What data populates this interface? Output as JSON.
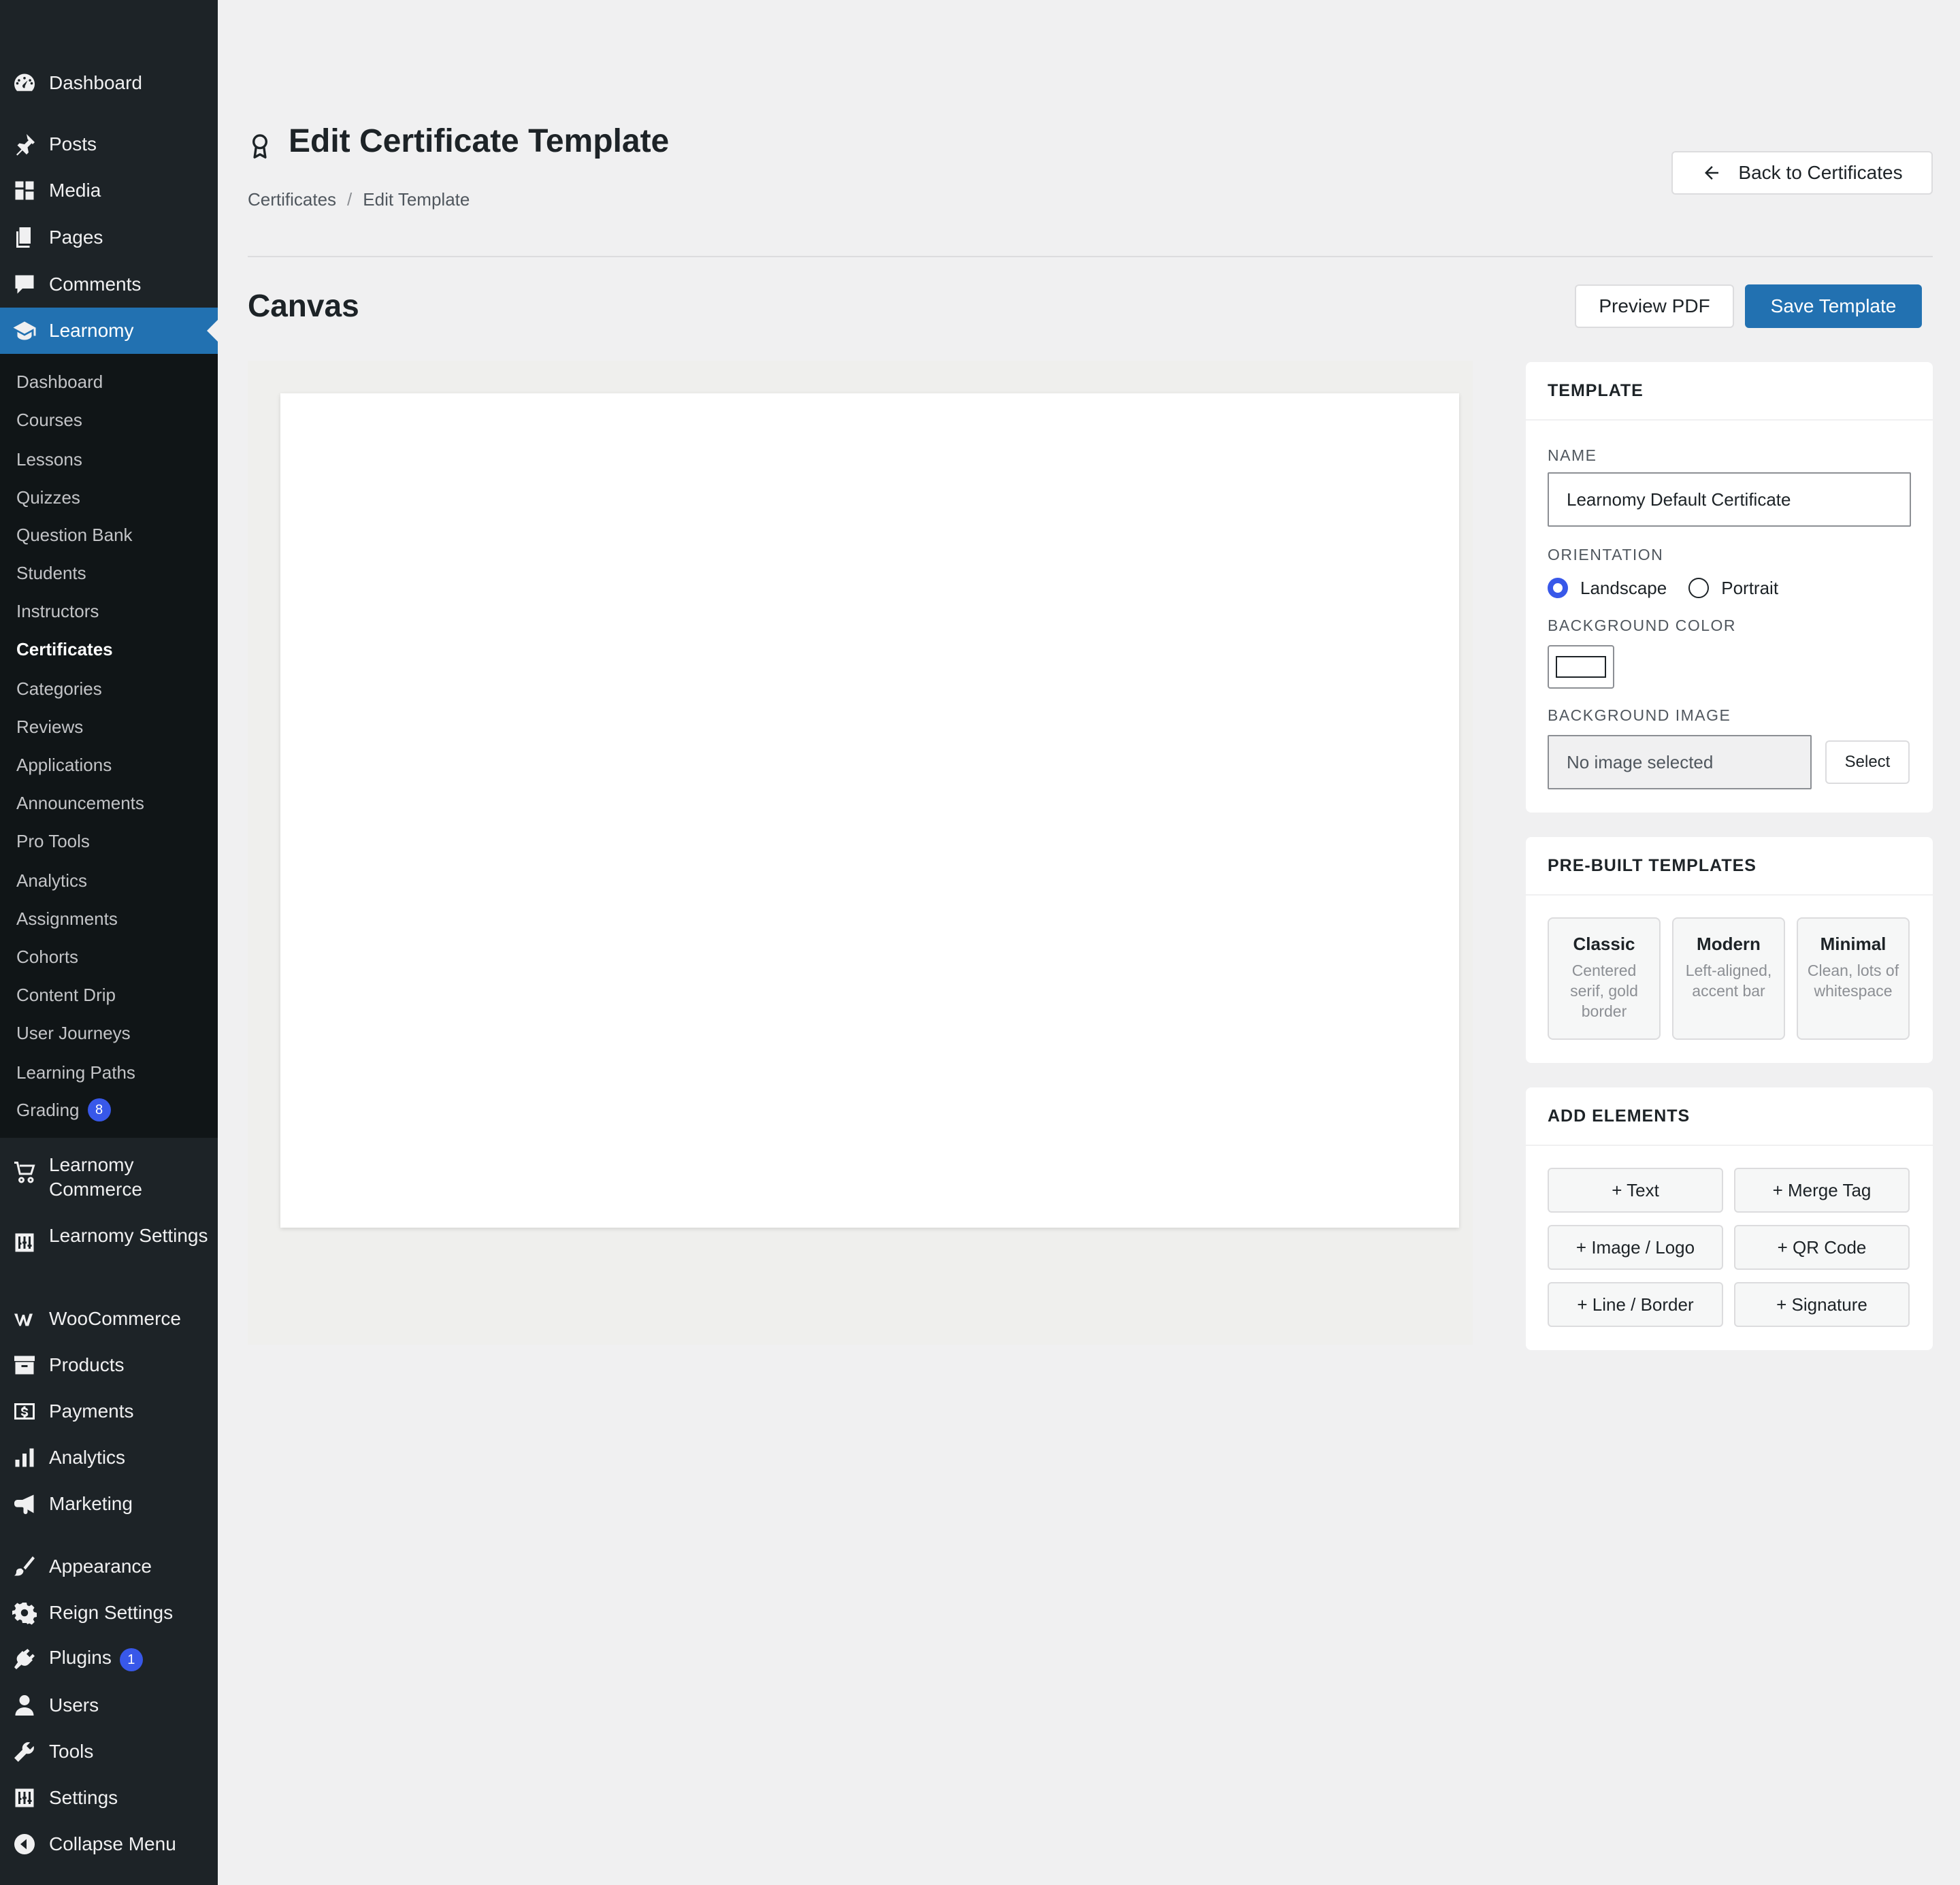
{
  "sidebar": {
    "top_items": [
      {
        "label": "Dashboard",
        "icon": "dashboard-icon"
      },
      {
        "label": "Posts",
        "icon": "pin-icon"
      },
      {
        "label": "Media",
        "icon": "media-icon"
      },
      {
        "label": "Pages",
        "icon": "pages-icon"
      },
      {
        "label": "Comments",
        "icon": "comment-icon"
      },
      {
        "label": "Learnomy",
        "icon": "graduation-cap-icon"
      }
    ],
    "submenu": [
      {
        "label": "Dashboard"
      },
      {
        "label": "Courses"
      },
      {
        "label": "Lessons"
      },
      {
        "label": "Quizzes"
      },
      {
        "label": "Question Bank"
      },
      {
        "label": "Students"
      },
      {
        "label": "Instructors"
      },
      {
        "label": "Certificates"
      },
      {
        "label": "Categories"
      },
      {
        "label": "Reviews"
      },
      {
        "label": "Applications"
      },
      {
        "label": "Announcements"
      },
      {
        "label": "Pro Tools"
      },
      {
        "label": "Analytics"
      },
      {
        "label": "Assignments"
      },
      {
        "label": "Cohorts"
      },
      {
        "label": "Content Drip"
      },
      {
        "label": "User Journeys"
      },
      {
        "label": "Learning Paths"
      },
      {
        "label": "Grading",
        "badge": "8"
      }
    ],
    "lower_items": [
      {
        "label": "Learnomy Commerce",
        "icon": "cart-icon"
      },
      {
        "label": "Learnomy Settings",
        "icon": "settings-sliders-icon"
      },
      {
        "label": "WooCommerce",
        "icon": "woocommerce-icon"
      },
      {
        "label": "Products",
        "icon": "archive-icon"
      },
      {
        "label": "Payments",
        "icon": "dollar-icon"
      },
      {
        "label": "Analytics",
        "icon": "bar-chart-icon"
      },
      {
        "label": "Marketing",
        "icon": "megaphone-icon"
      },
      {
        "label": "Appearance",
        "icon": "paintbrush-icon"
      },
      {
        "label": "Reign Settings",
        "icon": "gear-icon"
      },
      {
        "label": "Plugins",
        "icon": "plug-icon",
        "badge": "1"
      },
      {
        "label": "Users",
        "icon": "user-icon"
      },
      {
        "label": "Tools",
        "icon": "wrench-icon"
      },
      {
        "label": "Settings",
        "icon": "settings-sliders-icon"
      },
      {
        "label": "Collapse Menu",
        "icon": "collapse-icon"
      }
    ]
  },
  "header": {
    "title": "Edit Certificate Template",
    "title_icon": "award-icon",
    "breadcrumb": [
      "Certificates",
      "Edit Template"
    ],
    "breadcrumb_separator": "/",
    "back_button": "Back to Certificates"
  },
  "canvas": {
    "title": "Canvas",
    "preview_button": "Preview PDF",
    "save_button": "Save Template"
  },
  "template_panel": {
    "heading": "TEMPLATE",
    "name_label": "NAME",
    "name_value": "Learnomy Default Certificate",
    "orientation_label": "ORIENTATION",
    "orientation_options": [
      "Landscape",
      "Portrait"
    ],
    "orientation_selected": "Landscape",
    "bg_color_label": "BACKGROUND COLOR",
    "bg_color_value": "#ffffff",
    "bg_image_label": "BACKGROUND IMAGE",
    "bg_image_value": "No image selected",
    "select_button": "Select"
  },
  "prebuilt_panel": {
    "heading": "PRE-BUILT TEMPLATES",
    "templates": [
      {
        "name": "Classic",
        "description": "Centered serif, gold border"
      },
      {
        "name": "Modern",
        "description": "Left-aligned, accent bar"
      },
      {
        "name": "Minimal",
        "description": "Clean, lots of whitespace"
      }
    ]
  },
  "elements_panel": {
    "heading": "ADD ELEMENTS",
    "buttons": [
      "+ Text",
      "+ Merge Tag",
      "+ Image / Logo",
      "+ QR Code",
      "+ Line / Border",
      "+ Signature"
    ]
  },
  "colors": {
    "sidebar_bg": "#1d2327",
    "submenu_bg": "#101517",
    "accent": "#2271b1",
    "badge": "#3858e9",
    "page_bg": "#f0f0f1"
  }
}
